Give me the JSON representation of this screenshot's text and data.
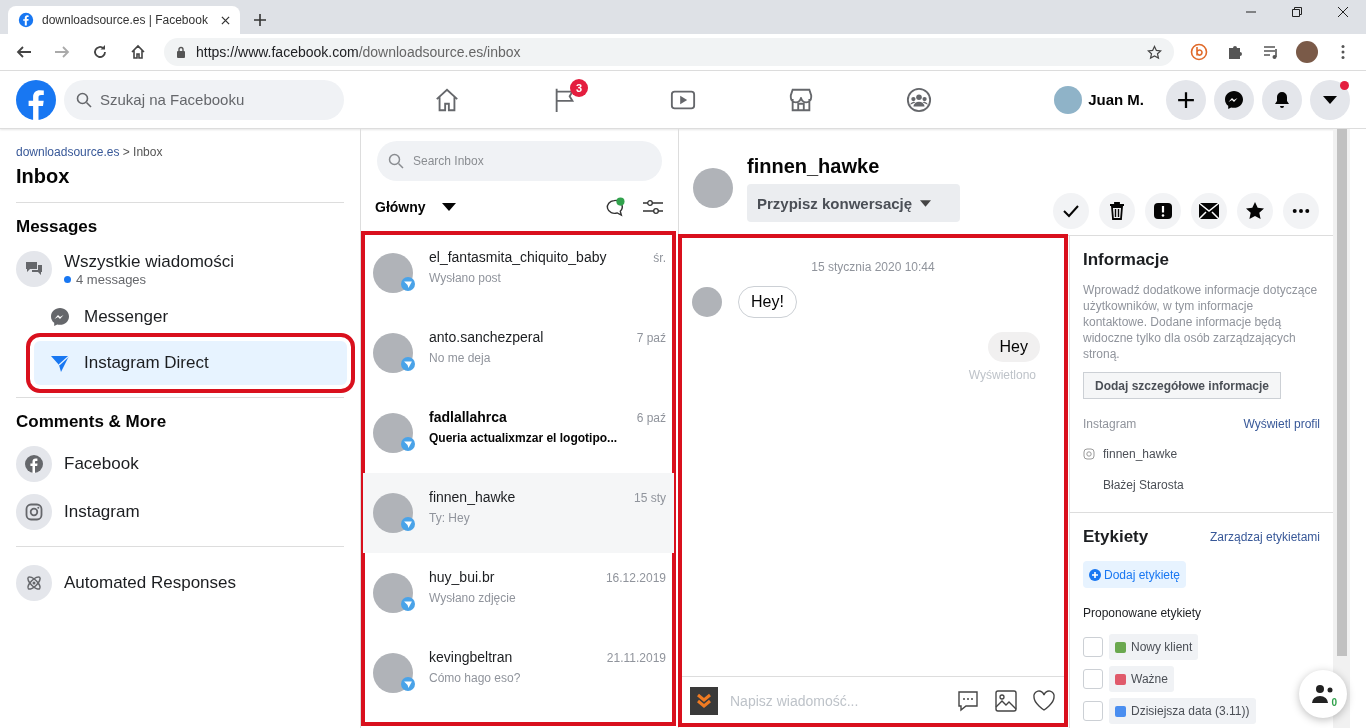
{
  "browser": {
    "tab_title": "downloadsource.es | Facebook",
    "url_host": "https://www.facebook.com",
    "url_path": "/downloadsource.es/inbox"
  },
  "header": {
    "search_placeholder": "Szukaj na Facebooku",
    "nav": [
      {
        "kind": "home"
      },
      {
        "kind": "pages",
        "badge": "3"
      },
      {
        "kind": "watch"
      },
      {
        "kind": "marketplace"
      },
      {
        "kind": "groups"
      }
    ],
    "user_name": "Juan M.",
    "menu_dot": true
  },
  "sidebar": {
    "breadcrumb_link": "downloadsource.es",
    "breadcrumb_rest": "> Inbox",
    "title": "Inbox",
    "sections": [
      {
        "title": "Messages",
        "items": [
          {
            "kind": "all",
            "label": "Wszystkie wiadomości",
            "subtitle": "4 messages",
            "selected": false,
            "highlighted": false,
            "children": [
              {
                "kind": "messenger",
                "label": "Messenger",
                "selected": false,
                "highlighted": false
              },
              {
                "kind": "direct",
                "label": "Instagram Direct",
                "selected": true,
                "highlighted": true
              }
            ]
          }
        ]
      },
      {
        "title": "Comments & More",
        "items": [
          {
            "kind": "facebook",
            "label": "Facebook",
            "selected": false,
            "highlighted": false
          },
          {
            "kind": "instagram",
            "label": "Instagram",
            "selected": false,
            "highlighted": false
          }
        ]
      },
      {
        "items": [
          {
            "kind": "automated",
            "label": "Automated Responses",
            "selected": false,
            "highlighted": false
          }
        ]
      }
    ]
  },
  "inbox": {
    "search_placeholder": "Search Inbox",
    "filter": "Główny",
    "highlighted": true,
    "conversations": [
      {
        "name": "el_fantasmita_chiquito_baby",
        "preview": "Wysłano post",
        "time": "śr.",
        "unread": false,
        "selected": false
      },
      {
        "name": "anto.sanchezperal",
        "preview": "No me deja",
        "time": "7 paź",
        "unread": false,
        "selected": false
      },
      {
        "name": "fadlallahrca",
        "preview": "Queria actualixmzar el logotipo...",
        "time": "6 paź",
        "unread": true,
        "selected": false
      },
      {
        "name": "finnen_hawke",
        "preview": "Ty: Hey",
        "time": "15 sty",
        "unread": false,
        "selected": true
      },
      {
        "name": "huy_bui.br",
        "preview": "Wysłano zdjęcie",
        "time": "16.12.2019",
        "unread": false,
        "selected": false
      },
      {
        "name": "kevingbeltran",
        "preview": "Cómo hago eso?",
        "time": "21.11.2019",
        "unread": false,
        "selected": false
      }
    ]
  },
  "chat": {
    "name": "finnen_hawke",
    "assign": "Przypisz konwersację",
    "highlighted": true,
    "date": "15 stycznia 2020 10:44",
    "messages": [
      {
        "kind": "incoming",
        "text": "Hey!"
      },
      {
        "kind": "outgoing",
        "text": "Hey",
        "status": "Wyświetlono"
      }
    ],
    "composer_placeholder": "Napisz wiadomość..."
  },
  "info": {
    "title": "Informacje",
    "description": "Wprowadź dodatkowe informacje dotyczące użytkowników, w tym informacje kontaktowe. Dodane informacje będą widoczne tylko dla osób zarządzających stroną.",
    "add_details": "Dodaj szczegółowe informacje",
    "instagram_label": "Instagram",
    "view_profile": "Wyświetl profil",
    "handle": "finnen_hawke",
    "real_name": "Błażej Starosta",
    "labels_title": "Etykiety",
    "manage_labels": "Zarządzaj etykietami",
    "add_label": "Dodaj etykietę",
    "suggested_title": "Proponowane etykiety",
    "suggested": [
      {
        "label": "Nowy klient",
        "color": "#6aa84f",
        "checked": false
      },
      {
        "label": "Ważne",
        "color": "#e05a6b",
        "checked": false
      },
      {
        "label": "Dzisiejsza data (3.11))",
        "color": "#4a8ef0",
        "checked": false
      }
    ]
  },
  "people_count": "0"
}
